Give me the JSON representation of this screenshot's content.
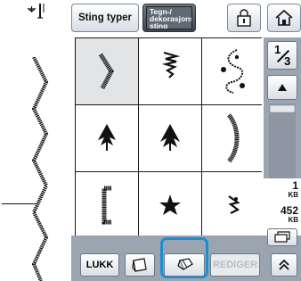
{
  "toolbar": {
    "tab_sting": "Sting typer",
    "tab_tegn": "Tegn-/ dekorasjons- sting",
    "lock_icon": "lock-icon",
    "home_icon": "home-icon"
  },
  "side": {
    "page_current": "1",
    "page_total": "3",
    "memory_used": "1",
    "memory_used_unit": "KB",
    "memory_total": "452",
    "memory_total_unit": "KB"
  },
  "bottom": {
    "close_label": "LUKK",
    "edit_label": "REDIGER"
  },
  "colors": {
    "accent": "#1b8fd6",
    "panel": "#9aa5b1"
  }
}
